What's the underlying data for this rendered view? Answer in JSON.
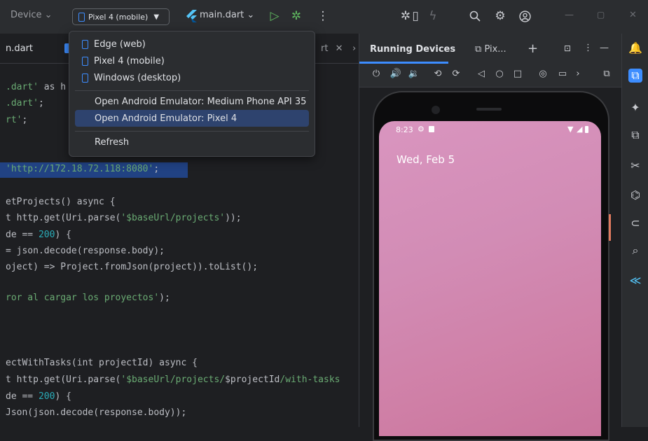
{
  "toolbar": {
    "device_label": "Device",
    "device_selector": "Pixel 4 (mobile)",
    "run_config": "main.dart",
    "win_minimize": "—",
    "win_restore": "▢",
    "win_close": "✕"
  },
  "editor": {
    "tabs": [
      {
        "label": "n.dart"
      },
      {
        "label": "rt"
      }
    ],
    "lines": [
      {
        "parts": [
          {
            "t": ".dart'",
            "c": "str"
          },
          {
            "t": " as h",
            "c": ""
          }
        ]
      },
      {
        "parts": [
          {
            "t": ".dart'",
            "c": "str"
          },
          {
            "t": ";",
            "c": ""
          }
        ]
      },
      {
        "parts": [
          {
            "t": "rt'",
            "c": "str"
          },
          {
            "t": ";",
            "c": ""
          }
        ]
      },
      {
        "parts": [
          {
            "t": "'http://172.18.72.118:8080'",
            "c": "str"
          },
          {
            "t": ";",
            "c": ""
          }
        ]
      },
      {
        "parts": [
          {
            "t": "etProjects() async {",
            "c": ""
          }
        ]
      },
      {
        "parts": [
          {
            "t": "t http.get(Uri.parse(",
            "c": ""
          },
          {
            "t": "'$baseUrl",
            "c": "str"
          },
          {
            "t": "/projects'",
            "c": "str"
          },
          {
            "t": "));",
            "c": ""
          }
        ]
      },
      {
        "parts": [
          {
            "t": "de == ",
            "c": ""
          },
          {
            "t": "200",
            "c": "num"
          },
          {
            "t": ") {",
            "c": ""
          }
        ]
      },
      {
        "parts": [
          {
            "t": "= json.decode(response.body);",
            "c": ""
          }
        ]
      },
      {
        "parts": [
          {
            "t": "oject) => Project.fromJson(project)).toList();",
            "c": ""
          }
        ]
      },
      {
        "parts": [
          {
            "t": "ror al cargar los proyectos'",
            "c": "str"
          },
          {
            "t": ");",
            "c": ""
          }
        ]
      },
      {
        "parts": [
          {
            "t": "ectWithTasks(int projectId) async {",
            "c": ""
          }
        ]
      },
      {
        "parts": [
          {
            "t": "t http.get(Uri.parse(",
            "c": ""
          },
          {
            "t": "'$baseUrl",
            "c": "str"
          },
          {
            "t": "/projects/",
            "c": "str"
          },
          {
            "t": "$projectId",
            "c": ""
          },
          {
            "t": "/with-tasks",
            "c": "str"
          }
        ]
      },
      {
        "parts": [
          {
            "t": "de == ",
            "c": ""
          },
          {
            "t": "200",
            "c": "num"
          },
          {
            "t": ") {",
            "c": ""
          }
        ]
      },
      {
        "parts": [
          {
            "t": "Json(json.decode(response.body));",
            "c": ""
          }
        ]
      }
    ]
  },
  "dropdown": {
    "items": [
      {
        "label": "Edge (web)",
        "icon": "phone-icon"
      },
      {
        "label": "Pixel 4 (mobile)",
        "icon": "phone-icon"
      },
      {
        "label": "Windows (desktop)",
        "icon": "phone-icon"
      },
      {
        "label": "Open Android Emulator: Medium Phone API 35"
      },
      {
        "label": "Open Android Emulator: Pixel 4",
        "selected": true
      },
      {
        "label": "Refresh"
      }
    ]
  },
  "panel": {
    "title": "Running Devices",
    "tab_label": "Pix..."
  },
  "phone": {
    "time": "8:23",
    "date": "Wed, Feb 5"
  },
  "colors": {
    "accent": "#3d8dff",
    "selection": "#2e436e",
    "wallpaper": "#d28cb5"
  }
}
